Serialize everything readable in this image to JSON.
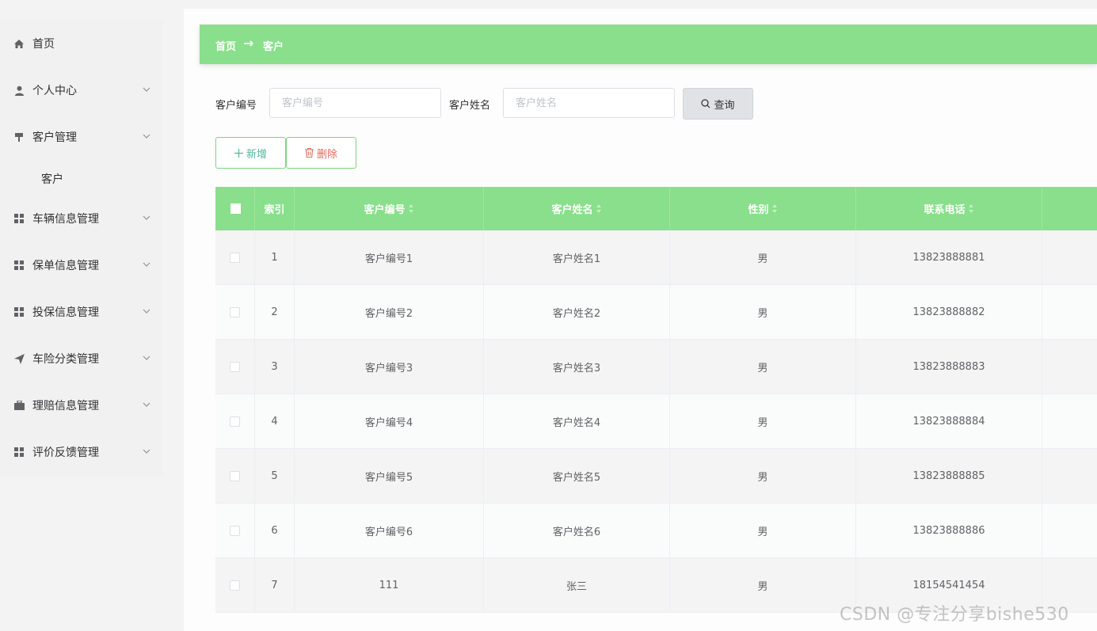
{
  "sidebar": {
    "items": [
      {
        "label": "首页",
        "icon": "home-icon",
        "arrow": false
      },
      {
        "label": "个人中心",
        "icon": "user-icon",
        "arrow": true
      },
      {
        "label": "客户管理",
        "icon": "pin-icon",
        "arrow": true
      },
      {
        "label": "车辆信息管理",
        "icon": "grid-icon",
        "arrow": true
      },
      {
        "label": "保单信息管理",
        "icon": "grid-icon",
        "arrow": true
      },
      {
        "label": "投保信息管理",
        "icon": "grid-icon",
        "arrow": true
      },
      {
        "label": "车险分类管理",
        "icon": "send-icon",
        "arrow": true
      },
      {
        "label": "理赔信息管理",
        "icon": "briefcase-icon",
        "arrow": true
      },
      {
        "label": "评价反馈管理",
        "icon": "grid-icon",
        "arrow": true
      }
    ],
    "sub_item": "客户"
  },
  "breadcrumb": {
    "home": "首页",
    "separator": "→",
    "current": "客户"
  },
  "search": {
    "field1_label": "客户编号",
    "field1_placeholder": "客户编号",
    "field2_label": "客户姓名",
    "field2_placeholder": "客户姓名",
    "query_label": "查询"
  },
  "actions": {
    "add_label": "新增",
    "delete_label": "删除"
  },
  "table": {
    "columns": [
      "索引",
      "客户编号",
      "客户姓名",
      "性别",
      "联系电话"
    ],
    "rows": [
      {
        "index": "1",
        "code": "客户编号1",
        "name": "客户姓名1",
        "gender": "男",
        "phone": "13823888881"
      },
      {
        "index": "2",
        "code": "客户编号2",
        "name": "客户姓名2",
        "gender": "男",
        "phone": "13823888882"
      },
      {
        "index": "3",
        "code": "客户编号3",
        "name": "客户姓名3",
        "gender": "男",
        "phone": "13823888883"
      },
      {
        "index": "4",
        "code": "客户编号4",
        "name": "客户姓名4",
        "gender": "男",
        "phone": "13823888884"
      },
      {
        "index": "5",
        "code": "客户编号5",
        "name": "客户姓名5",
        "gender": "男",
        "phone": "13823888885"
      },
      {
        "index": "6",
        "code": "客户编号6",
        "name": "客户姓名6",
        "gender": "男",
        "phone": "13823888886"
      },
      {
        "index": "7",
        "code": "111",
        "name": "张三",
        "gender": "男",
        "phone": "18154541454"
      }
    ]
  },
  "watermark": "CSDN @专注分享bishe530",
  "colors": {
    "accent": "#89df8b",
    "delete": "#e06c5c",
    "add": "#55b6a0"
  }
}
